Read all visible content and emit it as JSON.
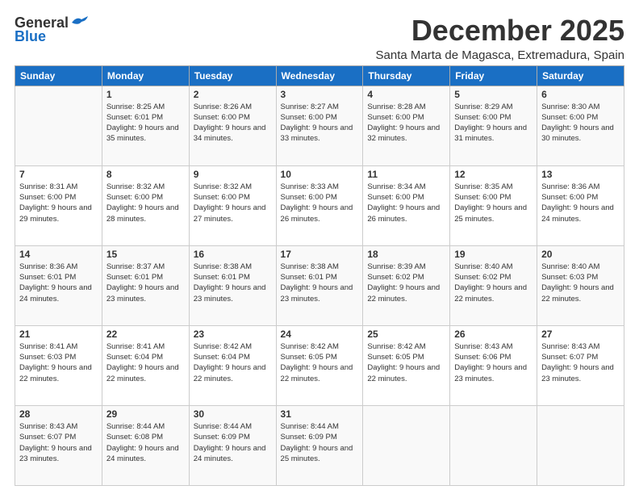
{
  "logo": {
    "general": "General",
    "blue": "Blue"
  },
  "title": "December 2025",
  "location": "Santa Marta de Magasca, Extremadura, Spain",
  "headers": [
    "Sunday",
    "Monday",
    "Tuesday",
    "Wednesday",
    "Thursday",
    "Friday",
    "Saturday"
  ],
  "weeks": [
    [
      {
        "day": "",
        "sunrise": "",
        "sunset": "",
        "daylight": ""
      },
      {
        "day": "1",
        "sunrise": "Sunrise: 8:25 AM",
        "sunset": "Sunset: 6:01 PM",
        "daylight": "Daylight: 9 hours and 35 minutes."
      },
      {
        "day": "2",
        "sunrise": "Sunrise: 8:26 AM",
        "sunset": "Sunset: 6:00 PM",
        "daylight": "Daylight: 9 hours and 34 minutes."
      },
      {
        "day": "3",
        "sunrise": "Sunrise: 8:27 AM",
        "sunset": "Sunset: 6:00 PM",
        "daylight": "Daylight: 9 hours and 33 minutes."
      },
      {
        "day": "4",
        "sunrise": "Sunrise: 8:28 AM",
        "sunset": "Sunset: 6:00 PM",
        "daylight": "Daylight: 9 hours and 32 minutes."
      },
      {
        "day": "5",
        "sunrise": "Sunrise: 8:29 AM",
        "sunset": "Sunset: 6:00 PM",
        "daylight": "Daylight: 9 hours and 31 minutes."
      },
      {
        "day": "6",
        "sunrise": "Sunrise: 8:30 AM",
        "sunset": "Sunset: 6:00 PM",
        "daylight": "Daylight: 9 hours and 30 minutes."
      }
    ],
    [
      {
        "day": "7",
        "sunrise": "Sunrise: 8:31 AM",
        "sunset": "Sunset: 6:00 PM",
        "daylight": "Daylight: 9 hours and 29 minutes."
      },
      {
        "day": "8",
        "sunrise": "Sunrise: 8:32 AM",
        "sunset": "Sunset: 6:00 PM",
        "daylight": "Daylight: 9 hours and 28 minutes."
      },
      {
        "day": "9",
        "sunrise": "Sunrise: 8:32 AM",
        "sunset": "Sunset: 6:00 PM",
        "daylight": "Daylight: 9 hours and 27 minutes."
      },
      {
        "day": "10",
        "sunrise": "Sunrise: 8:33 AM",
        "sunset": "Sunset: 6:00 PM",
        "daylight": "Daylight: 9 hours and 26 minutes."
      },
      {
        "day": "11",
        "sunrise": "Sunrise: 8:34 AM",
        "sunset": "Sunset: 6:00 PM",
        "daylight": "Daylight: 9 hours and 26 minutes."
      },
      {
        "day": "12",
        "sunrise": "Sunrise: 8:35 AM",
        "sunset": "Sunset: 6:00 PM",
        "daylight": "Daylight: 9 hours and 25 minutes."
      },
      {
        "day": "13",
        "sunrise": "Sunrise: 8:36 AM",
        "sunset": "Sunset: 6:00 PM",
        "daylight": "Daylight: 9 hours and 24 minutes."
      }
    ],
    [
      {
        "day": "14",
        "sunrise": "Sunrise: 8:36 AM",
        "sunset": "Sunset: 6:01 PM",
        "daylight": "Daylight: 9 hours and 24 minutes."
      },
      {
        "day": "15",
        "sunrise": "Sunrise: 8:37 AM",
        "sunset": "Sunset: 6:01 PM",
        "daylight": "Daylight: 9 hours and 23 minutes."
      },
      {
        "day": "16",
        "sunrise": "Sunrise: 8:38 AM",
        "sunset": "Sunset: 6:01 PM",
        "daylight": "Daylight: 9 hours and 23 minutes."
      },
      {
        "day": "17",
        "sunrise": "Sunrise: 8:38 AM",
        "sunset": "Sunset: 6:01 PM",
        "daylight": "Daylight: 9 hours and 23 minutes."
      },
      {
        "day": "18",
        "sunrise": "Sunrise: 8:39 AM",
        "sunset": "Sunset: 6:02 PM",
        "daylight": "Daylight: 9 hours and 22 minutes."
      },
      {
        "day": "19",
        "sunrise": "Sunrise: 8:40 AM",
        "sunset": "Sunset: 6:02 PM",
        "daylight": "Daylight: 9 hours and 22 minutes."
      },
      {
        "day": "20",
        "sunrise": "Sunrise: 8:40 AM",
        "sunset": "Sunset: 6:03 PM",
        "daylight": "Daylight: 9 hours and 22 minutes."
      }
    ],
    [
      {
        "day": "21",
        "sunrise": "Sunrise: 8:41 AM",
        "sunset": "Sunset: 6:03 PM",
        "daylight": "Daylight: 9 hours and 22 minutes."
      },
      {
        "day": "22",
        "sunrise": "Sunrise: 8:41 AM",
        "sunset": "Sunset: 6:04 PM",
        "daylight": "Daylight: 9 hours and 22 minutes."
      },
      {
        "day": "23",
        "sunrise": "Sunrise: 8:42 AM",
        "sunset": "Sunset: 6:04 PM",
        "daylight": "Daylight: 9 hours and 22 minutes."
      },
      {
        "day": "24",
        "sunrise": "Sunrise: 8:42 AM",
        "sunset": "Sunset: 6:05 PM",
        "daylight": "Daylight: 9 hours and 22 minutes."
      },
      {
        "day": "25",
        "sunrise": "Sunrise: 8:42 AM",
        "sunset": "Sunset: 6:05 PM",
        "daylight": "Daylight: 9 hours and 22 minutes."
      },
      {
        "day": "26",
        "sunrise": "Sunrise: 8:43 AM",
        "sunset": "Sunset: 6:06 PM",
        "daylight": "Daylight: 9 hours and 23 minutes."
      },
      {
        "day": "27",
        "sunrise": "Sunrise: 8:43 AM",
        "sunset": "Sunset: 6:07 PM",
        "daylight": "Daylight: 9 hours and 23 minutes."
      }
    ],
    [
      {
        "day": "28",
        "sunrise": "Sunrise: 8:43 AM",
        "sunset": "Sunset: 6:07 PM",
        "daylight": "Daylight: 9 hours and 23 minutes."
      },
      {
        "day": "29",
        "sunrise": "Sunrise: 8:44 AM",
        "sunset": "Sunset: 6:08 PM",
        "daylight": "Daylight: 9 hours and 24 minutes."
      },
      {
        "day": "30",
        "sunrise": "Sunrise: 8:44 AM",
        "sunset": "Sunset: 6:09 PM",
        "daylight": "Daylight: 9 hours and 24 minutes."
      },
      {
        "day": "31",
        "sunrise": "Sunrise: 8:44 AM",
        "sunset": "Sunset: 6:09 PM",
        "daylight": "Daylight: 9 hours and 25 minutes."
      },
      {
        "day": "",
        "sunrise": "",
        "sunset": "",
        "daylight": ""
      },
      {
        "day": "",
        "sunrise": "",
        "sunset": "",
        "daylight": ""
      },
      {
        "day": "",
        "sunrise": "",
        "sunset": "",
        "daylight": ""
      }
    ]
  ]
}
